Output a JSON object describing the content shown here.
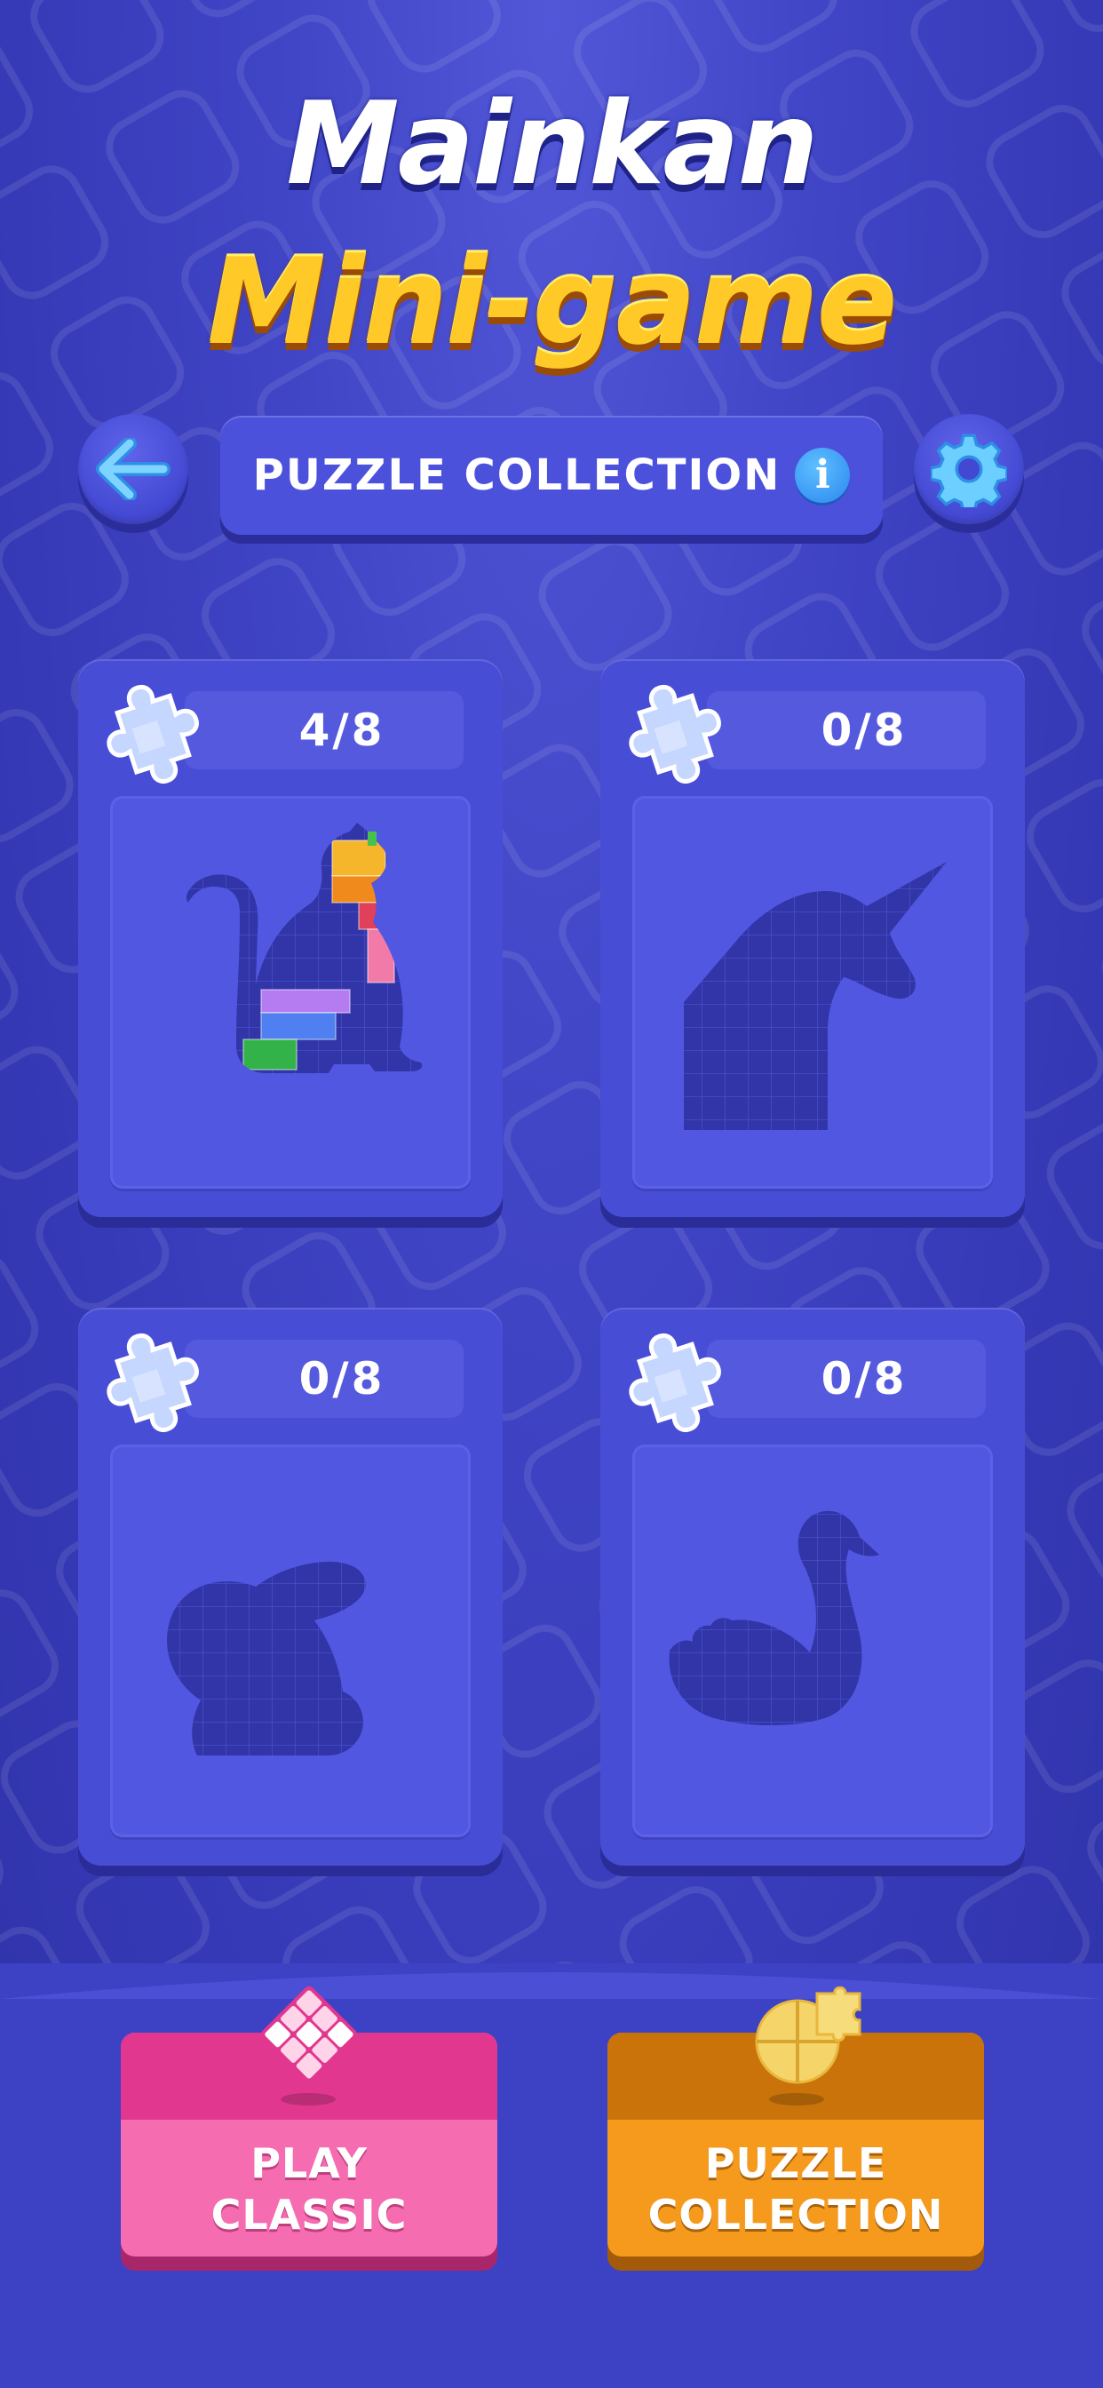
{
  "title": {
    "line1": "Mainkan",
    "line2": "Mini-game"
  },
  "header": {
    "label": "PUZZLE COLLECTION",
    "info_icon": "i"
  },
  "cards": [
    {
      "progress": "4/8",
      "completed": 4,
      "total": 8,
      "picture": "cat"
    },
    {
      "progress": "0/8",
      "completed": 0,
      "total": 8,
      "picture": "unicorn"
    },
    {
      "progress": "0/8",
      "completed": 0,
      "total": 8,
      "picture": "rabbit"
    },
    {
      "progress": "0/8",
      "completed": 0,
      "total": 8,
      "picture": "swan"
    }
  ],
  "modes": {
    "classic_label_line1": "PLAY",
    "classic_label_line2": "CLASSIC",
    "puzzle_label_line1": "PUZZLE",
    "puzzle_label_line2": "COLLECTION"
  },
  "colors": {
    "background": "#4045c6",
    "title_yellow": "#ffc928",
    "classic_pink": "#f56cb0",
    "puzzle_orange": "#f59a1c",
    "info_blue": "#2a86f0"
  },
  "icons": {
    "back": "arrow-left-icon",
    "settings": "gear-icon",
    "info": "info-icon",
    "card_badge": "puzzle-piece-icon",
    "classic": "diamond-blocks-icon",
    "puzzle": "jigsaw-icon"
  }
}
